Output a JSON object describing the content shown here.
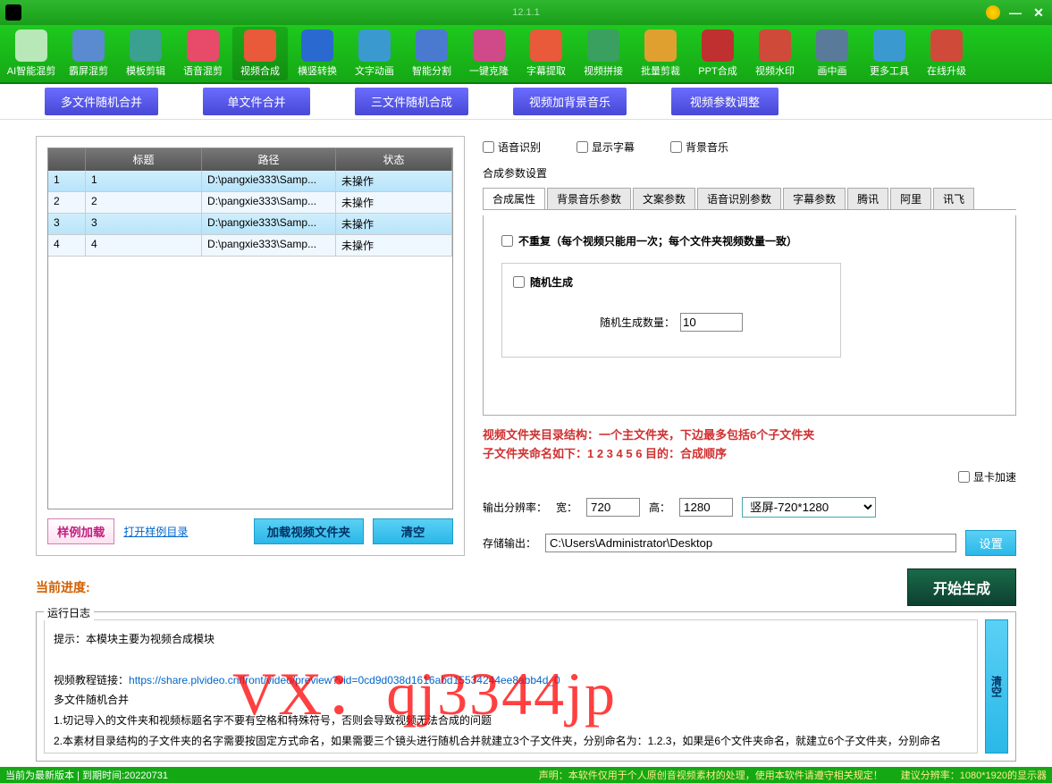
{
  "version": "12.1.1",
  "toolbar": [
    {
      "label": "AI智能混剪",
      "bg": "#b8e8b8"
    },
    {
      "label": "霸屏混剪",
      "bg": "#5a8ad0"
    },
    {
      "label": "模板剪辑",
      "bg": "#3aa090"
    },
    {
      "label": "语音混剪",
      "bg": "#e84a6a"
    },
    {
      "label": "视频合成",
      "bg": "#e85a3a",
      "active": true
    },
    {
      "label": "横竖转换",
      "bg": "#2a6ad0"
    },
    {
      "label": "文字动画",
      "bg": "#3a9ad0"
    },
    {
      "label": "智能分割",
      "bg": "#4a7ad0"
    },
    {
      "label": "一键克隆",
      "bg": "#d04a8a"
    },
    {
      "label": "字幕提取",
      "bg": "#e85a3a"
    },
    {
      "label": "视频拼接",
      "bg": "#3aa060"
    },
    {
      "label": "批量剪裁",
      "bg": "#e0a030"
    },
    {
      "label": "PPT合成",
      "bg": "#c03030"
    },
    {
      "label": "视频水印",
      "bg": "#d04a3a"
    },
    {
      "label": "画中画",
      "bg": "#5a7a9a"
    },
    {
      "label": "更多工具",
      "bg": "#3a9ad0"
    },
    {
      "label": "在线升级",
      "bg": "#d04a3a"
    }
  ],
  "tabs": [
    "多文件随机合并",
    "单文件合并",
    "三文件随机合成",
    "视频加背景音乐",
    "视频参数调整"
  ],
  "table": {
    "headers": {
      "num": "",
      "title": "标题",
      "path": "路径",
      "status": "状态"
    },
    "rows": [
      {
        "num": "1",
        "title": "1",
        "path": "D:\\pangxie333\\Samp...",
        "status": "未操作"
      },
      {
        "num": "2",
        "title": "2",
        "path": "D:\\pangxie333\\Samp...",
        "status": "未操作"
      },
      {
        "num": "3",
        "title": "3",
        "path": "D:\\pangxie333\\Samp...",
        "status": "未操作"
      },
      {
        "num": "4",
        "title": "4",
        "path": "D:\\pangxie333\\Samp...",
        "status": "未操作"
      }
    ]
  },
  "left_actions": {
    "sample": "样例加载",
    "open_dir": "打开样例目录",
    "load": "加载视频文件夹",
    "clear": "清空"
  },
  "checks": {
    "voice": "语音识别",
    "subtitle": "显示字幕",
    "bgm": "背景音乐"
  },
  "params_title": "合成参数设置",
  "subtabs": [
    "合成属性",
    "背景音乐参数",
    "文案参数",
    "语音识别参数",
    "字幕参数",
    "腾讯",
    "阿里",
    "讯飞"
  ],
  "noRepeat": "不重复（每个视频只能用一次；每个文件夹视频数量一致）",
  "randGen": "随机生成",
  "randCountLabel": "随机生成数量：",
  "randCount": "10",
  "hint1": "视频文件夹目录结构：一个主文件夹，下边最多包括6个子文件夹",
  "hint2": "子文件夹命名如下：1 2 3 4 5 6        目的：合成顺序",
  "gpu": "显卡加速",
  "resolution": {
    "label": "输出分辨率：",
    "w_label": "宽：",
    "w": "720",
    "h_label": "高：",
    "h": "1280",
    "preset": "竖屏-720*1280"
  },
  "storage": {
    "label": "存储输出：",
    "path": "C:\\Users\\Administrator\\Desktop",
    "set": "设置"
  },
  "progress": "当前进度:",
  "start": "开始生成",
  "log": {
    "legend": "运行日志",
    "l1": "提示：本模块主要为视频合成模块",
    "l2a": "视频教程链接：",
    "l2b": "https://share.plvideo.cn/front/video/preview?vid=0cd9d038d1616abd15534244ee8abb4d_0",
    "l3": "多文件随机合并",
    "l4": "1.切记导入的文件夹和视频标题名字不要有空格和特殊符号，否则会导致视频无法合成的问题",
    "l5": "2.本素材目录结构的子文件夹的名字需要按固定方式命名，如果需要三个镜头进行随机合并就建立3个子文件夹，分别命名为：1.2.3，如果是6个文件夹命名，就建立6个子文件夹，分别命名",
    "clear": "清空"
  },
  "status": {
    "left": "当前为最新版本 | 到期时间:20220731",
    "r1": "声明：本软件仅用于个人原创音视频素材的处理，使用本软件请遵守相关规定！",
    "r2": "建议分辨率：1080*1920的显示器"
  },
  "watermark": "VX：qj3344jp"
}
